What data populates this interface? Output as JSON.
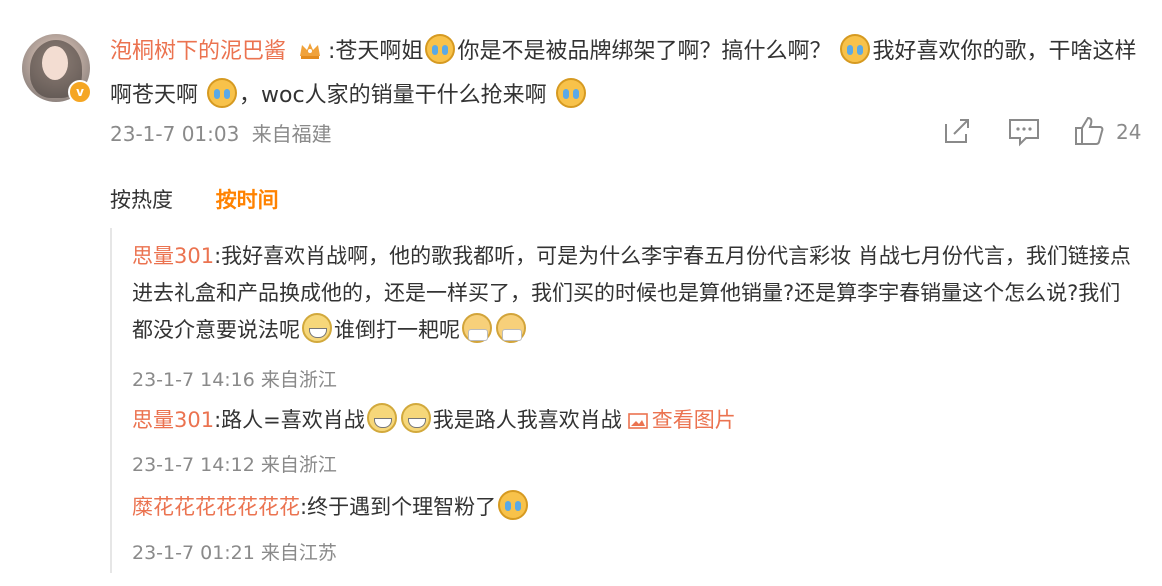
{
  "main_comment": {
    "username": "泡桐树下的泥巴酱",
    "segments": [
      ":苍天啊姐",
      "你是不是被品牌绑架了啊？搞什么啊？",
      "我好喜欢你的歌，干啥这样啊苍天啊",
      "，woc人家的销量干什么抢来啊"
    ],
    "timestamp": "23-1-7 01:03",
    "location": "来自福建",
    "like_count": "24"
  },
  "sort": {
    "hot": "按热度",
    "time": "按时间"
  },
  "replies": [
    {
      "username": "思量301",
      "text_a": ":我好喜欢肖战啊，他的歌我都听，可是为什么李宇春五月份代言彩妆 肖战七月份代言，我们链接点进去礼盒和产品换成他的，还是一样买了，我们买的时候也是算他销量?还是算李宇春销量这个怎么说?我们都没介意要说法呢",
      "text_b": "谁倒打一耙呢",
      "meta": "23-1-7 14:16 来自浙江"
    },
    {
      "username": "思量301",
      "text_a": ":路人=喜欢肖战",
      "text_b": "我是路人我喜欢肖战",
      "view_image": "查看图片",
      "meta": "23-1-7 14:12 来自浙江"
    },
    {
      "username": "糜花花花花花花花",
      "text_a": ":终于遇到个理智粉了",
      "meta": "23-1-7 01:21 来自江苏"
    }
  ],
  "icons": {
    "crown": "crown-badge-icon",
    "cry": "crying-emoji-icon",
    "grin": "grin-emoji-icon",
    "mask": "mask-emoji-icon",
    "share": "share-icon",
    "comment": "comment-icon",
    "like": "thumbs-up-icon",
    "image": "image-icon"
  },
  "colors": {
    "username": "#eb7350",
    "accent": "#ff8200",
    "meta": "#8a8a8a"
  }
}
